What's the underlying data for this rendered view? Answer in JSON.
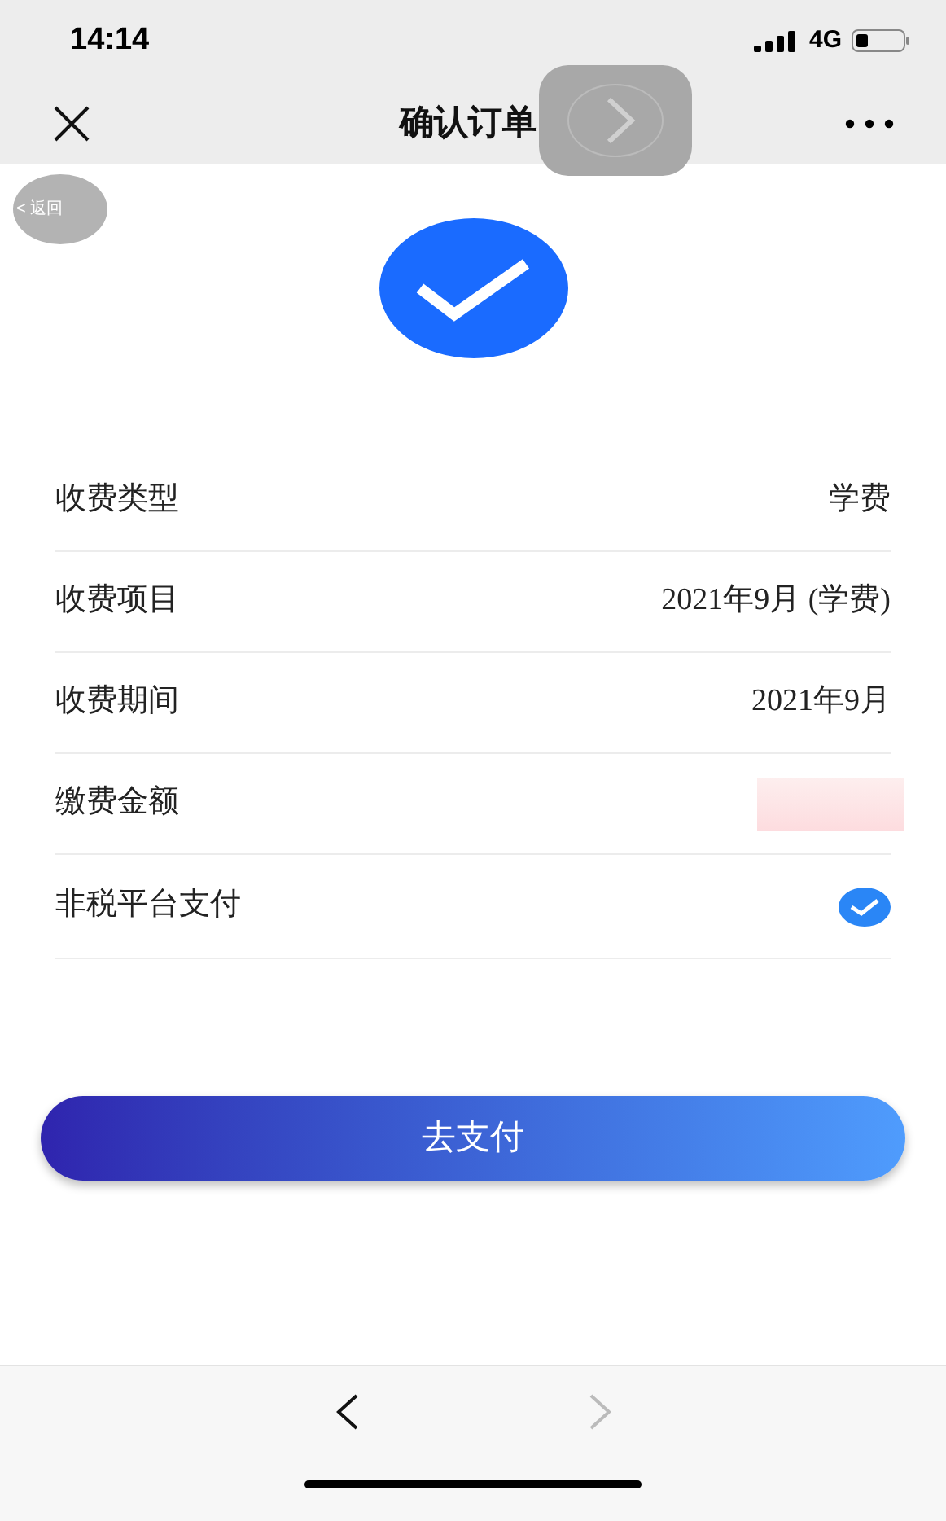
{
  "status_bar": {
    "time": "14:14",
    "network": "4G"
  },
  "nav_bar": {
    "title": "确认订单"
  },
  "back_bubble": {
    "label": "< 返回"
  },
  "rows": [
    {
      "kind": "text",
      "label": "收费类型",
      "value": "学费"
    },
    {
      "kind": "text",
      "label": "收费项目",
      "value": "2021年9月 (学费)"
    },
    {
      "kind": "text",
      "label": "收费期间",
      "value": "2021年9月"
    },
    {
      "kind": "redacted",
      "label": "缴费金额"
    },
    {
      "kind": "check",
      "label": "非税平台支付",
      "checked": true
    }
  ],
  "pay_button": {
    "label": "去支付"
  },
  "browser_bar": {
    "back_disabled": false,
    "forward_disabled": true
  }
}
